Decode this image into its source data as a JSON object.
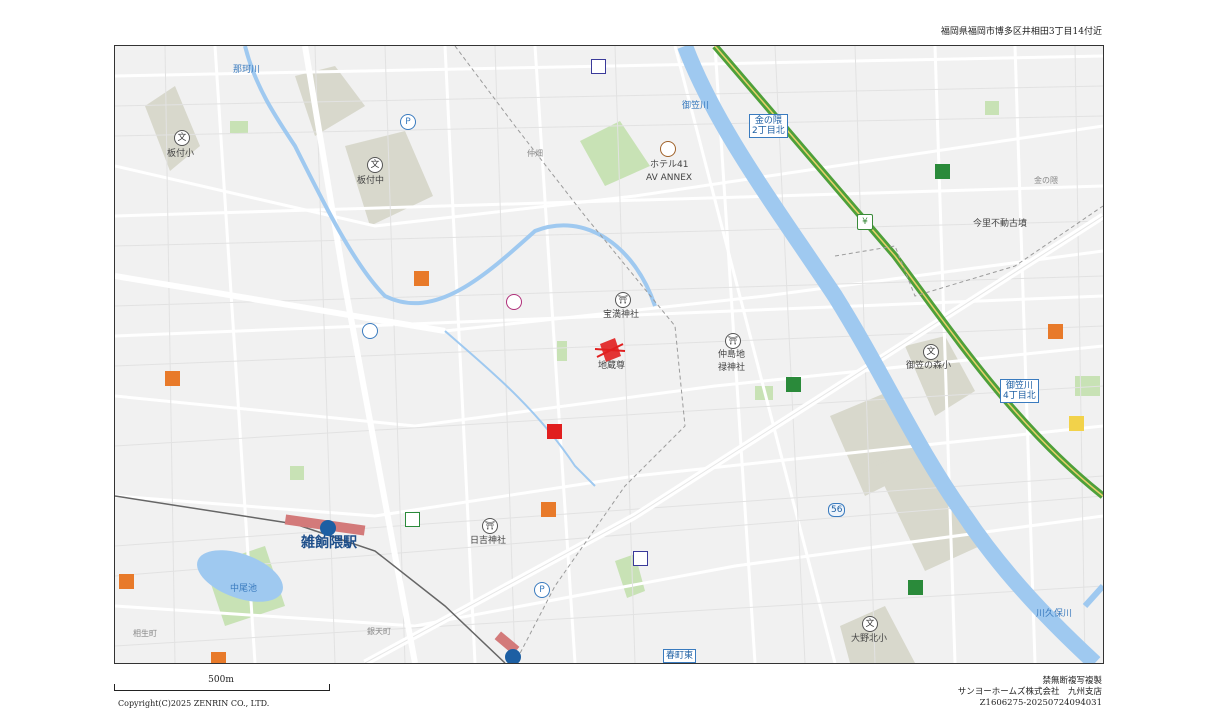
{
  "header": {
    "address": "福岡県福岡市博多区井相田3丁目14付近"
  },
  "map": {
    "labels": {
      "nakagawa": "那珂川",
      "itazuke_elem": "板付小",
      "itazuke_junior": "板付中",
      "naka": "仲畑",
      "hotel": "ホテル41",
      "hotel2": "AV ANNEX",
      "mikasa_river": "御笠川",
      "kanenokuma": "金の隈",
      "imazato_tumulus": "今里不動古墳",
      "hojin_shrine": "宝満神社",
      "jizo": "地蔵尊",
      "nakajima1": "仲島地",
      "nakajima2": "禄神社",
      "mikasanomori": "御笠の森小",
      "hiyoshi": "日吉神社",
      "station": "雑餉隈駅",
      "nakaoike": "中尾池",
      "aiomachi": "相生町",
      "bentencho": "銀天町",
      "onokita": "大野北小",
      "kubogawa": "川久保川",
      "route": "56"
    },
    "signs": {
      "kanenokuma_2": [
        "金の隈",
        "2丁目北"
      ],
      "mikasa_4": [
        "御笠川",
        "4丁目北"
      ],
      "kasugamachi": "春町東"
    },
    "icons": {
      "school": "文",
      "shrine": "⛩",
      "parking": "P",
      "bank": "¥"
    },
    "colors": {
      "water": "#9fc9f0",
      "park": "#c8e2b5",
      "highway": "#4ea03a",
      "roadLine": "#d9d9d9",
      "railway": "#666666",
      "station": "#d37a7a",
      "highlight": "#e11f1f"
    }
  },
  "scale": {
    "label": "500m"
  },
  "copyright": "Copyright(C)2025 ZENRIN CO., LTD.",
  "footer": {
    "line1": "禁無断複写複製",
    "line2": "サンヨーホームズ株式会社　九州支店",
    "line3": "Z1606275-20250724094031"
  }
}
